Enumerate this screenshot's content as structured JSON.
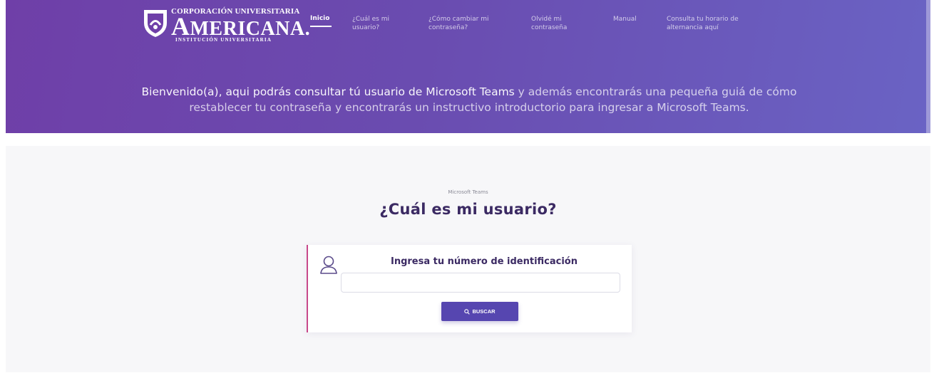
{
  "brand": {
    "top_line": "CORPORACIÓN UNIVERSITARIA",
    "name_initial": "A",
    "name_rest": "MERICANA.",
    "sub_line": "INSTITUCIÓN UNIVERSITARIA",
    "shield_icon": "shield-logo-icon"
  },
  "nav": {
    "items": [
      {
        "label": "Inicio",
        "active": true
      },
      {
        "label": "¿Cuál es mi usuario?"
      },
      {
        "label": "¿Cómo cambiar mi contraseña?"
      },
      {
        "label": "Olvidé mi contraseña"
      },
      {
        "label": "Manual"
      },
      {
        "label": "Consulta tu horario de alternancia aquí"
      }
    ]
  },
  "hero": {
    "welcome_strong": "Bienvenido(a), aqui podrás consultar tú usuario de Microsoft Teams",
    "welcome_rest": " y además encontrarás una pequeña guiá de cómo restablecer tu contraseña y encontrarás un instructivo introductorio para ingresar a Microsoft Teams."
  },
  "lookup": {
    "eyebrow": "Microsoft Teams",
    "title": "¿Cuál es mi usuario?",
    "label": "Ingresa tu número de identificación",
    "input_value": "",
    "input_placeholder": "",
    "button_label": "BUSCAR",
    "user_icon": "user-outline-icon",
    "search_icon": "search-icon"
  },
  "colors": {
    "hero_start": "#6f3fa8",
    "hero_end": "#6a63c4",
    "accent": "#5646b0",
    "card_border": "#c8488a",
    "title": "#3b2a63"
  }
}
